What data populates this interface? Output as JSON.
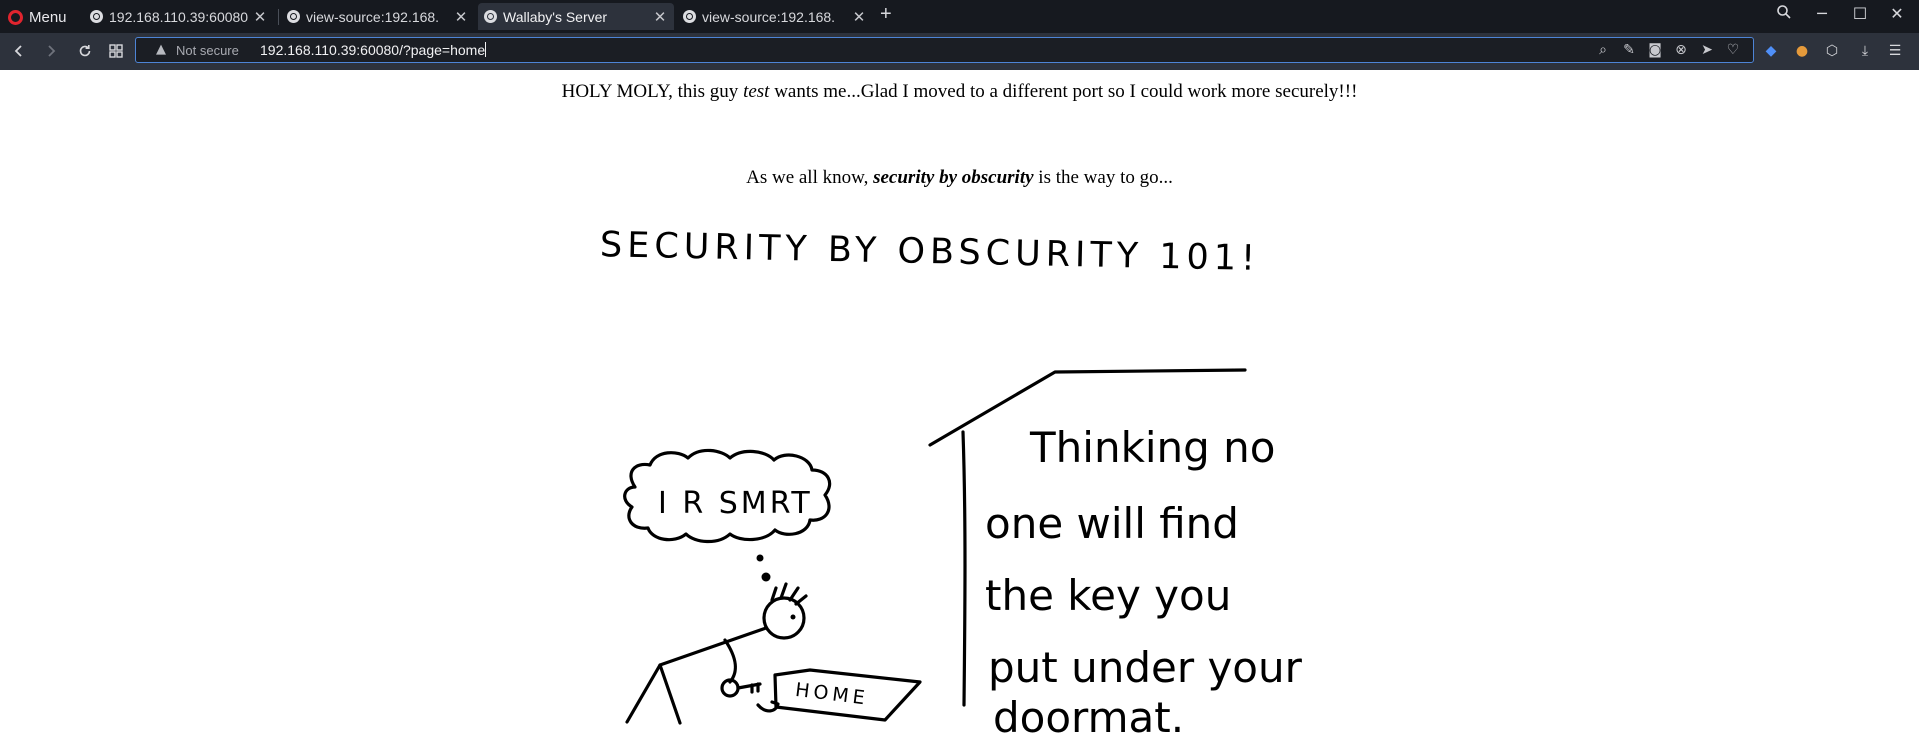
{
  "browser": {
    "menu_label": "Menu",
    "tabs": [
      {
        "label": "192.168.110.39:60080",
        "active": false
      },
      {
        "label": "view-source:192.168.",
        "active": false
      },
      {
        "label": "Wallaby's Server",
        "active": true
      },
      {
        "label": "view-source:192.168.",
        "active": false
      }
    ],
    "new_tab_symbol": "+",
    "security_label": "Not secure",
    "url": "192.168.110.39:60080/?page=home"
  },
  "page": {
    "line1_before": "HOLY MOLY, this guy ",
    "line1_em": "test",
    "line1_after": " wants me...Glad I moved to a different port so I could work more securely!!!",
    "line2_before": "As we all know, ",
    "line2_strong": "security by obscurity",
    "line2_after": " is the way to go..."
  },
  "comic": {
    "title": "SECURITY BY OBSCURITY 101!",
    "thought": "I R SMRT",
    "doormat": "HOME",
    "caption_lines": [
      "Thinking no",
      "one will find",
      "the key you",
      "put under your",
      "doormat."
    ]
  }
}
